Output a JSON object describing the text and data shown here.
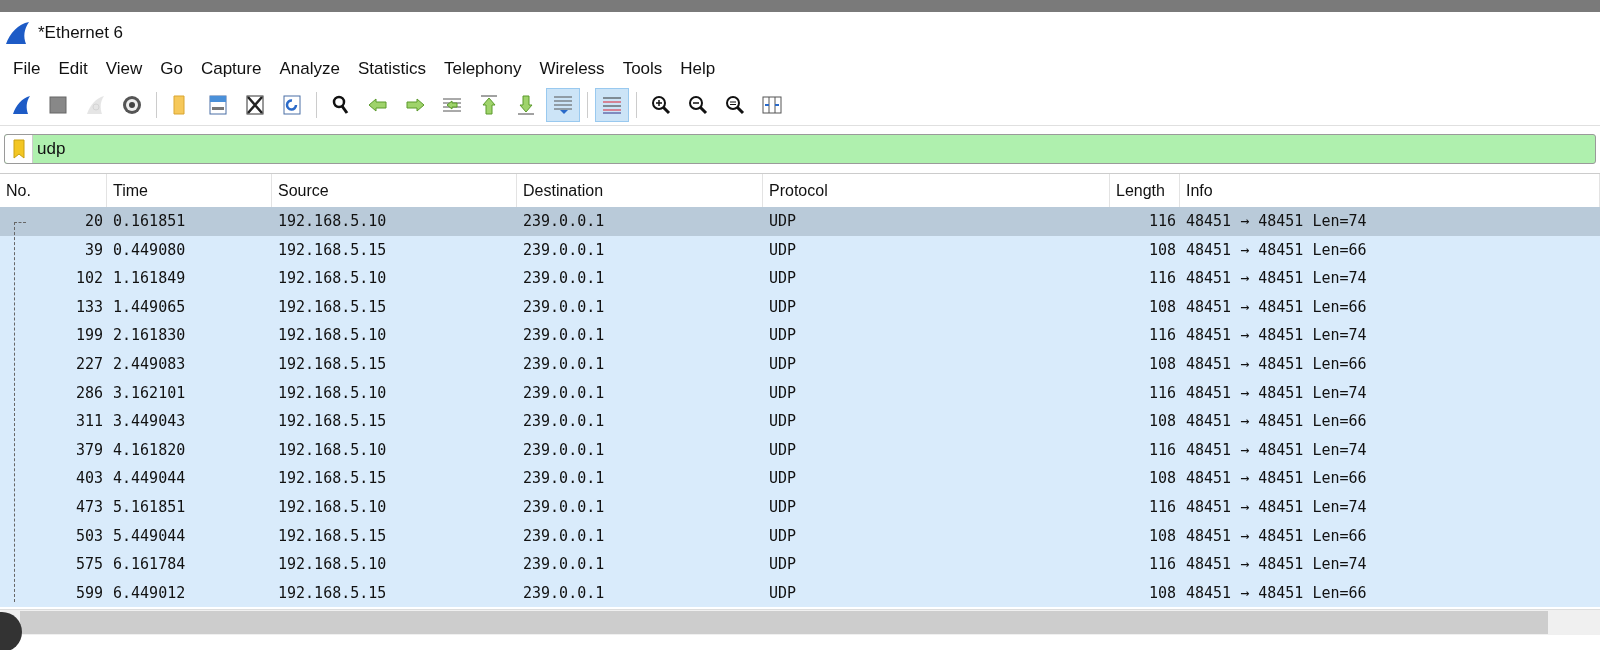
{
  "window": {
    "title": "*Ethernet 6"
  },
  "menu": [
    "File",
    "Edit",
    "View",
    "Go",
    "Capture",
    "Analyze",
    "Statistics",
    "Telephony",
    "Wireless",
    "Tools",
    "Help"
  ],
  "toolbar": {
    "groups": [
      [
        {
          "kind": "start",
          "on": false,
          "disabled": false
        },
        {
          "kind": "stop",
          "on": false,
          "disabled": false
        },
        {
          "kind": "restart",
          "on": false,
          "disabled": true
        },
        {
          "kind": "options",
          "on": false,
          "disabled": false
        }
      ],
      [
        {
          "kind": "open",
          "on": false,
          "disabled": false
        },
        {
          "kind": "save",
          "on": false,
          "disabled": false
        },
        {
          "kind": "close",
          "on": false,
          "disabled": false
        },
        {
          "kind": "reload",
          "on": false,
          "disabled": false
        }
      ],
      [
        {
          "kind": "find",
          "on": false,
          "disabled": false
        },
        {
          "kind": "back",
          "on": false,
          "disabled": false
        },
        {
          "kind": "forward",
          "on": false,
          "disabled": false
        },
        {
          "kind": "goto",
          "on": false,
          "disabled": false
        },
        {
          "kind": "first",
          "on": false,
          "disabled": false
        },
        {
          "kind": "last",
          "on": false,
          "disabled": false
        },
        {
          "kind": "autoscroll",
          "on": true,
          "disabled": false
        }
      ],
      [
        {
          "kind": "colorize",
          "on": true,
          "disabled": false
        }
      ],
      [
        {
          "kind": "zoomin",
          "on": false,
          "disabled": false
        },
        {
          "kind": "zoomout",
          "on": false,
          "disabled": false
        },
        {
          "kind": "zoomnormal",
          "on": false,
          "disabled": false
        },
        {
          "kind": "resize",
          "on": false,
          "disabled": false
        }
      ]
    ]
  },
  "filter": {
    "value": "udp"
  },
  "table": {
    "columns": [
      "No.",
      "Time",
      "Source",
      "Destination",
      "Protocol",
      "Length",
      "Info"
    ],
    "rows": [
      {
        "cells": [
          "20",
          "0.161851",
          "192.168.5.10",
          "239.0.0.1",
          "UDP",
          "116",
          "48451 → 48451 Len=74"
        ],
        "selected": true
      },
      {
        "cells": [
          "39",
          "0.449080",
          "192.168.5.15",
          "239.0.0.1",
          "UDP",
          "108",
          "48451 → 48451 Len=66"
        ],
        "selected": false
      },
      {
        "cells": [
          "102",
          "1.161849",
          "192.168.5.10",
          "239.0.0.1",
          "UDP",
          "116",
          "48451 → 48451 Len=74"
        ],
        "selected": false
      },
      {
        "cells": [
          "133",
          "1.449065",
          "192.168.5.15",
          "239.0.0.1",
          "UDP",
          "108",
          "48451 → 48451 Len=66"
        ],
        "selected": false
      },
      {
        "cells": [
          "199",
          "2.161830",
          "192.168.5.10",
          "239.0.0.1",
          "UDP",
          "116",
          "48451 → 48451 Len=74"
        ],
        "selected": false
      },
      {
        "cells": [
          "227",
          "2.449083",
          "192.168.5.15",
          "239.0.0.1",
          "UDP",
          "108",
          "48451 → 48451 Len=66"
        ],
        "selected": false
      },
      {
        "cells": [
          "286",
          "3.162101",
          "192.168.5.10",
          "239.0.0.1",
          "UDP",
          "116",
          "48451 → 48451 Len=74"
        ],
        "selected": false
      },
      {
        "cells": [
          "311",
          "3.449043",
          "192.168.5.15",
          "239.0.0.1",
          "UDP",
          "108",
          "48451 → 48451 Len=66"
        ],
        "selected": false
      },
      {
        "cells": [
          "379",
          "4.161820",
          "192.168.5.10",
          "239.0.0.1",
          "UDP",
          "116",
          "48451 → 48451 Len=74"
        ],
        "selected": false
      },
      {
        "cells": [
          "403",
          "4.449044",
          "192.168.5.15",
          "239.0.0.1",
          "UDP",
          "108",
          "48451 → 48451 Len=66"
        ],
        "selected": false
      },
      {
        "cells": [
          "473",
          "5.161851",
          "192.168.5.10",
          "239.0.0.1",
          "UDP",
          "116",
          "48451 → 48451 Len=74"
        ],
        "selected": false
      },
      {
        "cells": [
          "503",
          "5.449044",
          "192.168.5.15",
          "239.0.0.1",
          "UDP",
          "108",
          "48451 → 48451 Len=66"
        ],
        "selected": false
      },
      {
        "cells": [
          "575",
          "6.161784",
          "192.168.5.10",
          "239.0.0.1",
          "UDP",
          "116",
          "48451 → 48451 Len=74"
        ],
        "selected": false
      },
      {
        "cells": [
          "599",
          "6.449012",
          "192.168.5.15",
          "239.0.0.1",
          "UDP",
          "108",
          "48451 → 48451 Len=66"
        ],
        "selected": false
      }
    ]
  }
}
